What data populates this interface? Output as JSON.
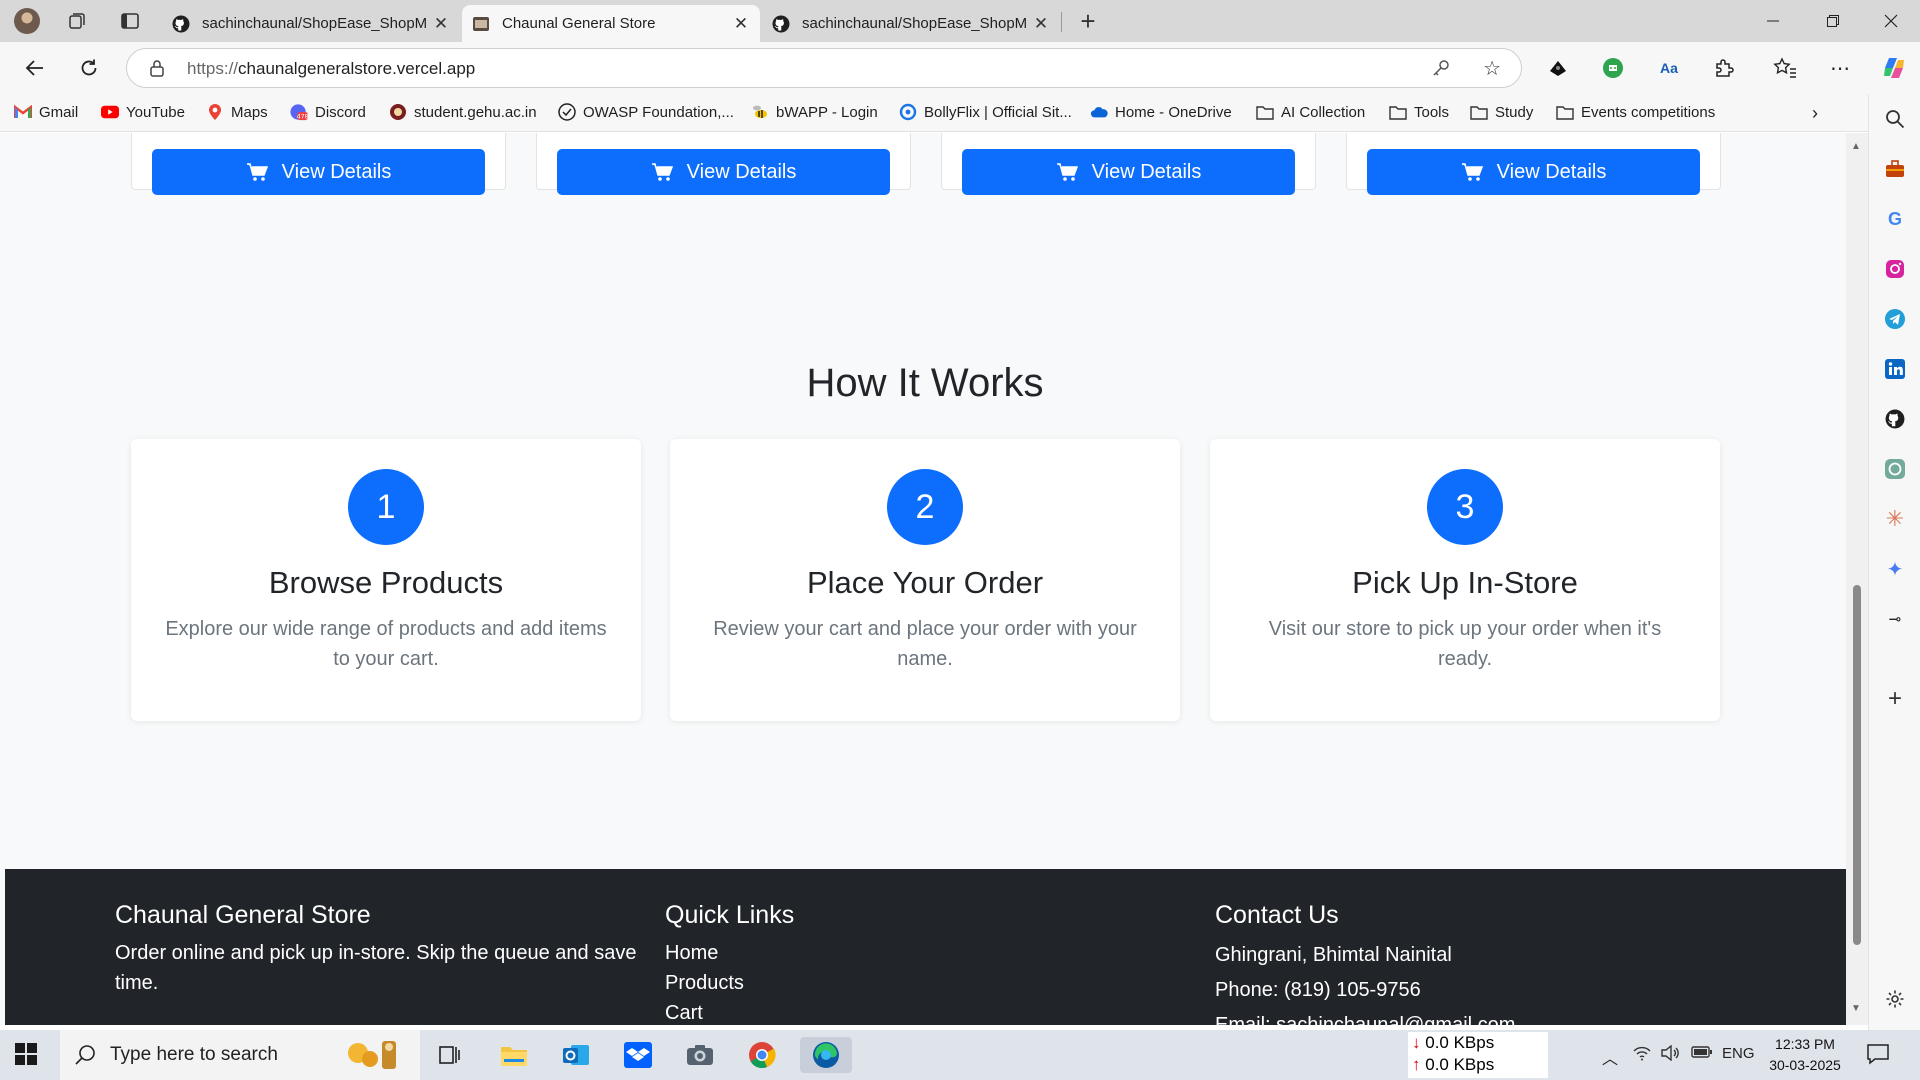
{
  "browser": {
    "tabs": [
      {
        "title": "sachinchaunal/ShopEase_ShopMa",
        "close": "✕"
      },
      {
        "title": "Chaunal General Store",
        "close": "✕"
      },
      {
        "title": "sachinchaunal/ShopEase_ShopMa",
        "close": "✕"
      }
    ],
    "new_tab": "+",
    "url_prefix": "https://",
    "url_host": "chaunalgeneralstore.vercel.app",
    "bookmarks": [
      {
        "label": "Gmail",
        "icon": "gmail-icon"
      },
      {
        "label": "YouTube",
        "icon": "youtube-icon"
      },
      {
        "label": "Maps",
        "icon": "maps-icon"
      },
      {
        "label": "Discord",
        "icon": "discord-icon"
      },
      {
        "label": "student.gehu.ac.in",
        "icon": "gehu-icon"
      },
      {
        "label": "OWASP Foundation,...",
        "icon": "owasp-icon"
      },
      {
        "label": "bWAPP - Login",
        "icon": "bee-icon"
      },
      {
        "label": "BollyFlix | Official Sit...",
        "icon": "bollyflix-icon"
      },
      {
        "label": "Home - OneDrive",
        "icon": "onedrive-icon"
      },
      {
        "label": "AI Collection",
        "icon": "folder-icon"
      },
      {
        "label": "Tools",
        "icon": "folder-icon"
      },
      {
        "label": "Study",
        "icon": "folder-icon"
      },
      {
        "label": "Events competitions",
        "icon": "folder-icon"
      }
    ]
  },
  "products": {
    "button_label": "View Details"
  },
  "how_it_works": {
    "title": "How It Works",
    "steps": [
      {
        "number": "1",
        "title": "Browse Products",
        "desc": "Explore our wide range of products and add items to your cart."
      },
      {
        "number": "2",
        "title": "Place Your Order",
        "desc": "Review your cart and place your order with your name."
      },
      {
        "number": "3",
        "title": "Pick Up In-Store",
        "desc": "Visit our store to pick up your order when it's ready."
      }
    ]
  },
  "footer": {
    "brand_title": "Chaunal General Store",
    "brand_text": "Order online and pick up in-store. Skip the queue and save time.",
    "links_title": "Quick Links",
    "links": [
      "Home",
      "Products",
      "Cart"
    ],
    "contact_title": "Contact Us",
    "address": "Ghingrani, Bhimtal Nainital",
    "phone": "Phone: (819) 105-9756",
    "email": "Email: sachinchaunal@gmail.com"
  },
  "taskbar": {
    "search_placeholder": "Type here to search",
    "net_down": "0.0 KBps",
    "net_up": "0.0 KBps",
    "language": "ENG",
    "time": "12:33 PM",
    "date": "30-03-2025"
  },
  "colors": {
    "primary": "#0d6efd",
    "footer_bg": "#212529",
    "page_bg": "#f8f9fa"
  }
}
